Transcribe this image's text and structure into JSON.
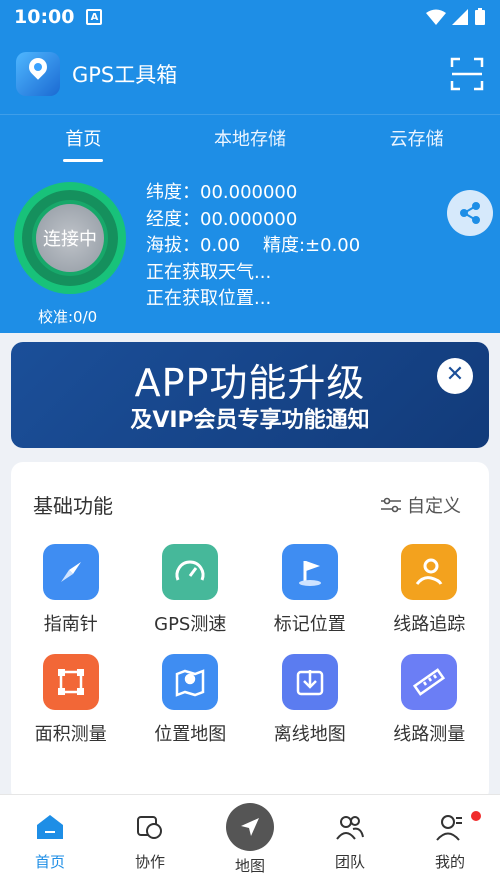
{
  "status_bar": {
    "time": "10:00",
    "notif_letter": "A"
  },
  "header": {
    "title": "GPS工具箱"
  },
  "tabs": [
    {
      "label": "首页"
    },
    {
      "label": "本地存储"
    },
    {
      "label": "云存储"
    }
  ],
  "gps": {
    "gauge_label": "连接中",
    "calibration": "校准:0/0",
    "lat": "纬度：00.000000",
    "lon": "经度：00.000000",
    "alt_acc": "海拔：0.00    精度:±0.00",
    "weather": "正在获取天气...",
    "location": "正在获取位置..."
  },
  "banner": {
    "line1": "APP功能升级",
    "line2": "及VIP会员专享功能通知"
  },
  "basic_functions": {
    "title": "基础功能",
    "customize": "自定义",
    "items": [
      {
        "label": "指南针",
        "icon": "compass-icon",
        "color": "#3f8df2"
      },
      {
        "label": "GPS测速",
        "icon": "speedometer-icon",
        "color": "#46b89a"
      },
      {
        "label": "标记位置",
        "icon": "flag-icon",
        "color": "#3f8df2"
      },
      {
        "label": "线路追踪",
        "icon": "route-track-icon",
        "color": "#f3a21e"
      },
      {
        "label": "面积测量",
        "icon": "area-icon",
        "color": "#f26737"
      },
      {
        "label": "位置地图",
        "icon": "map-pin-icon",
        "color": "#3f8df2"
      },
      {
        "label": "离线地图",
        "icon": "download-map-icon",
        "color": "#5b7cf0"
      },
      {
        "label": "线路测量",
        "icon": "ruler-icon",
        "color": "#6b7ef5"
      }
    ]
  },
  "bottom_nav": [
    {
      "label": "首页",
      "icon": "home-icon"
    },
    {
      "label": "协作",
      "icon": "collaborate-icon"
    },
    {
      "label": "地图",
      "icon": "navigate-icon"
    },
    {
      "label": "团队",
      "icon": "team-icon"
    },
    {
      "label": "我的",
      "icon": "profile-icon"
    }
  ]
}
